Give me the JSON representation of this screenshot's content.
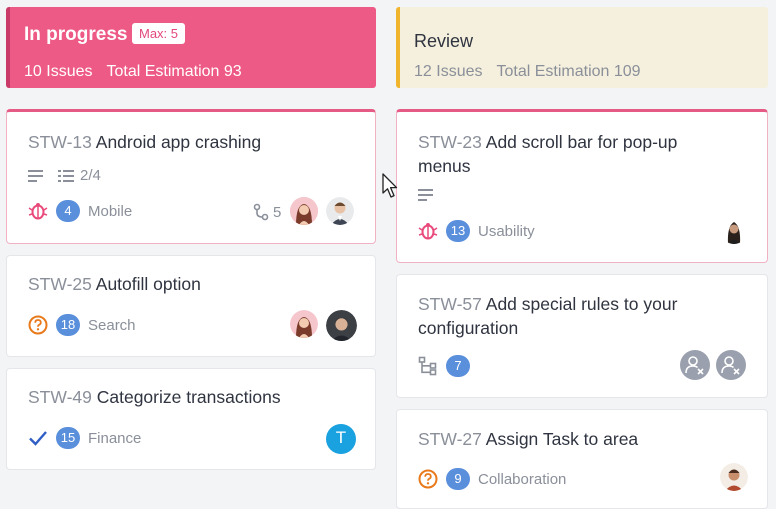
{
  "columns": {
    "in_progress": {
      "title": "In progress",
      "max_badge": "Max: 5",
      "issues": "10 Issues",
      "estimation": "Total Estimation 93",
      "accent": "#ee5a86"
    },
    "review": {
      "title": "Review",
      "issues": "12 Issues",
      "estimation": "Total Estimation 109",
      "accent": "#f1b52d"
    }
  },
  "cards_left": [
    {
      "key": "STW-13",
      "title": "Android app crashing",
      "checklist": "2/4",
      "type_icon": "bug-icon",
      "points": "4",
      "label": "Mobile",
      "subtasks": "5"
    },
    {
      "key": "STW-25",
      "title": "Autofill option",
      "type_icon": "question-icon",
      "points": "18",
      "label": "Search"
    },
    {
      "key": "STW-49",
      "title": "Categorize transactions",
      "type_icon": "check-icon",
      "points": "15",
      "label": "Finance",
      "assignee_initial": "T"
    }
  ],
  "cards_right": [
    {
      "key": "STW-23",
      "title_line1": "Add scroll bar for pop-up",
      "title_line2": "menus",
      "type_icon": "bug-icon",
      "points": "13",
      "label": "Usability"
    },
    {
      "key": "STW-57",
      "title_line1": "Add special rules to your",
      "title_line2": "configuration",
      "type_icon": "subtask-tree-icon",
      "points": "7"
    },
    {
      "key": "STW-27",
      "title": "Assign Task to area",
      "type_icon": "question-icon",
      "points": "9",
      "label": "Collaboration"
    }
  ]
}
